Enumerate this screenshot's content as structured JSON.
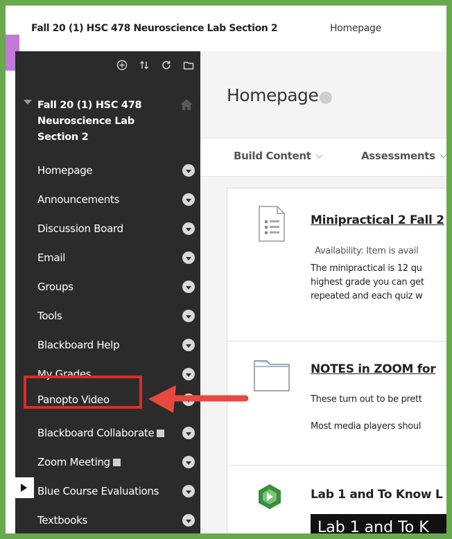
{
  "breadcrumb": {
    "course": "Fall 20 (1) HSC 478 Neuroscience Lab Section 2",
    "page": "Homepage"
  },
  "sidebar": {
    "course_title": "Fall 20 (1) HSC 478 Neuroscience Lab Section 2",
    "items": [
      {
        "label": "Homepage"
      },
      {
        "label": "Announcements"
      },
      {
        "label": "Discussion Board"
      },
      {
        "label": "Email"
      },
      {
        "label": "Groups"
      },
      {
        "label": "Tools"
      },
      {
        "label": "Blackboard Help"
      },
      {
        "label": "My Grades"
      },
      {
        "label": "Panopto Video"
      },
      {
        "label": "Blackboard Collaborate"
      },
      {
        "label": "Zoom Meeting"
      },
      {
        "label": "Blue Course Evaluations"
      },
      {
        "label": "Textbooks"
      }
    ]
  },
  "main": {
    "title": "Homepage",
    "toolbar": {
      "build_content": "Build Content",
      "assessments": "Assessments"
    },
    "items": [
      {
        "title": "Minipractical 2 Fall 2",
        "availability": "Availability:  Item is avail",
        "lines": [
          "The minipractical is 12 qu",
          "highest grade you can get",
          "repeated and each quiz w"
        ]
      },
      {
        "title": "NOTES in ZOOM for",
        "lines": [
          "These turn out to be prett",
          "Most media players shoul"
        ]
      },
      {
        "title": "Lab 1 and To Know L",
        "video_text": "Lab 1 and To K"
      }
    ]
  },
  "colors": {
    "sidebar_bg": "#2b2b2b",
    "highlight": "#e02b20",
    "arrow": "#e8493e",
    "frame": "#6aa84f",
    "tab_accent": "#c17ad6"
  }
}
